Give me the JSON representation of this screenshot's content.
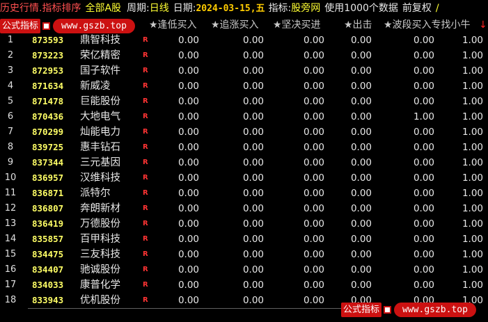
{
  "topbar": {
    "title": "历史行情.指标排序",
    "market": "全部A股",
    "period_label": "周期:",
    "period_value": "日线",
    "date_label": "日期:",
    "date_value": "2024-03-15,五",
    "indicator_label": "指标:",
    "indicator_value": "股旁网",
    "data_info": "使用1000个数据",
    "adjust": "前复权",
    "edge_mark": "/"
  },
  "badge": {
    "label": "公式指标",
    "url": "www.gszb.top"
  },
  "columns": [
    "★逢低买入",
    "★追涨买入",
    "★坚决买进",
    "★出击",
    "★波段买入专找小牛",
    "↓"
  ],
  "rows": [
    {
      "idx": "1",
      "code": "873593",
      "name": "鼎智科技",
      "flag": "R",
      "v": [
        "0.00",
        "0.00",
        "0.00",
        "0.00",
        "0.00",
        "1.00"
      ]
    },
    {
      "idx": "2",
      "code": "873223",
      "name": "荣亿精密",
      "flag": "R",
      "v": [
        "0.00",
        "0.00",
        "0.00",
        "0.00",
        "0.00",
        "1.00"
      ]
    },
    {
      "idx": "3",
      "code": "872953",
      "name": "国子软件",
      "flag": "R",
      "v": [
        "0.00",
        "0.00",
        "0.00",
        "0.00",
        "0.00",
        "1.00"
      ]
    },
    {
      "idx": "4",
      "code": "871634",
      "name": "新威凌",
      "flag": "R",
      "v": [
        "0.00",
        "0.00",
        "0.00",
        "0.00",
        "0.00",
        "1.00"
      ]
    },
    {
      "idx": "5",
      "code": "871478",
      "name": "巨能股份",
      "flag": "R",
      "v": [
        "0.00",
        "0.00",
        "0.00",
        "0.00",
        "0.00",
        "1.00"
      ]
    },
    {
      "idx": "6",
      "code": "870436",
      "name": "大地电气",
      "flag": "R",
      "v": [
        "0.00",
        "0.00",
        "0.00",
        "0.00",
        "1.00",
        "1.00"
      ]
    },
    {
      "idx": "7",
      "code": "870299",
      "name": "灿能电力",
      "flag": "R",
      "v": [
        "0.00",
        "0.00",
        "0.00",
        "0.00",
        "0.00",
        "1.00"
      ]
    },
    {
      "idx": "8",
      "code": "839725",
      "name": "惠丰钻石",
      "flag": "R",
      "v": [
        "0.00",
        "0.00",
        "0.00",
        "0.00",
        "0.00",
        "1.00"
      ]
    },
    {
      "idx": "9",
      "code": "837344",
      "name": "三元基因",
      "flag": "R",
      "v": [
        "0.00",
        "0.00",
        "0.00",
        "0.00",
        "0.00",
        "1.00"
      ]
    },
    {
      "idx": "10",
      "code": "836957",
      "name": "汉维科技",
      "flag": "R",
      "v": [
        "0.00",
        "0.00",
        "0.00",
        "0.00",
        "0.00",
        "1.00"
      ]
    },
    {
      "idx": "11",
      "code": "836871",
      "name": "派特尔",
      "flag": "R",
      "v": [
        "0.00",
        "0.00",
        "0.00",
        "0.00",
        "0.00",
        "1.00"
      ]
    },
    {
      "idx": "12",
      "code": "836807",
      "name": "奔朗新材",
      "flag": "R",
      "v": [
        "0.00",
        "0.00",
        "0.00",
        "0.00",
        "0.00",
        "1.00"
      ]
    },
    {
      "idx": "13",
      "code": "836419",
      "name": "万德股份",
      "flag": "R",
      "v": [
        "0.00",
        "0.00",
        "0.00",
        "0.00",
        "0.00",
        "1.00"
      ]
    },
    {
      "idx": "14",
      "code": "835857",
      "name": "百甲科技",
      "flag": "R",
      "v": [
        "0.00",
        "0.00",
        "0.00",
        "0.00",
        "0.00",
        "1.00"
      ]
    },
    {
      "idx": "15",
      "code": "834475",
      "name": "三友科技",
      "flag": "R",
      "v": [
        "0.00",
        "0.00",
        "0.00",
        "0.00",
        "0.00",
        "1.00"
      ]
    },
    {
      "idx": "16",
      "code": "834407",
      "name": "驰诚股份",
      "flag": "R",
      "v": [
        "0.00",
        "0.00",
        "0.00",
        "0.00",
        "0.00",
        "1.00"
      ]
    },
    {
      "idx": "17",
      "code": "834033",
      "name": "康普化学",
      "flag": "R",
      "v": [
        "0.00",
        "0.00",
        "0.00",
        "0.00",
        "0.00",
        "1.00"
      ]
    },
    {
      "idx": "18",
      "code": "833943",
      "name": "优机股份",
      "flag": "R",
      "v": [
        "0.00",
        "0.00",
        "0.00",
        "0.00",
        "0.00",
        "1.00"
      ]
    }
  ],
  "colors": {
    "background": "#000000",
    "code": "#ffff66",
    "flag": "#ff3333",
    "title": "#ff5050",
    "badge": "#cc1111"
  }
}
